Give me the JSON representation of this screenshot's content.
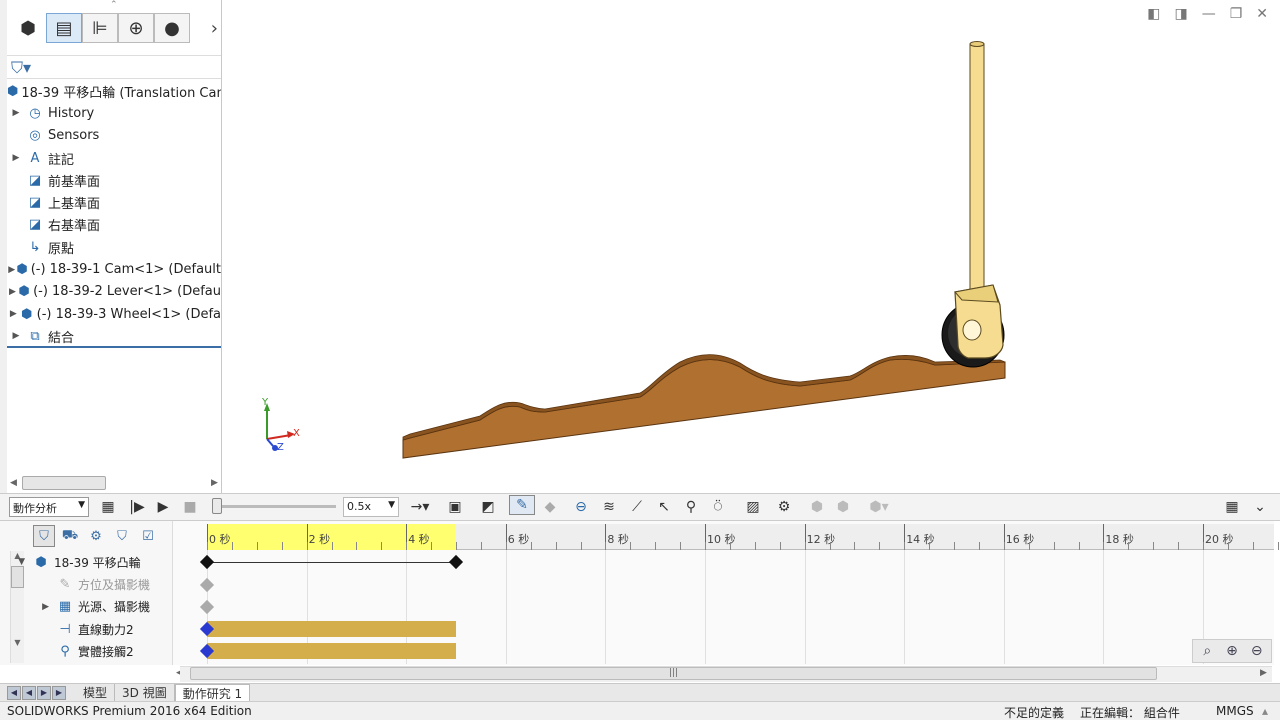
{
  "feature_tree": {
    "root": "18-39 平移凸輪 (Translation Cam",
    "items": [
      {
        "label": "History",
        "expand": true,
        "icon": "history-icon"
      },
      {
        "label": "Sensors",
        "expand": false,
        "icon": "sensors-icon"
      },
      {
        "label": "註記",
        "expand": true,
        "icon": "annotation-icon"
      },
      {
        "label": "前基準面",
        "expand": false,
        "icon": "plane-icon"
      },
      {
        "label": "上基準面",
        "expand": false,
        "icon": "plane-icon"
      },
      {
        "label": "右基準面",
        "expand": false,
        "icon": "plane-icon"
      },
      {
        "label": "原點",
        "expand": false,
        "icon": "origin-icon"
      },
      {
        "label": "(-) 18-39-1 Cam<1> (Default",
        "expand": true,
        "icon": "part-icon"
      },
      {
        "label": "(-) 18-39-2 Lever<1> (Defau",
        "expand": true,
        "icon": "part-icon"
      },
      {
        "label": "(-) 18-39-3 Wheel<1> (Defa",
        "expand": true,
        "icon": "part-icon"
      },
      {
        "label": "結合",
        "expand": true,
        "icon": "mates-icon"
      }
    ]
  },
  "axes_triad": {
    "x": "X",
    "y": "Y",
    "z": "Z"
  },
  "motion": {
    "study_type": "動作分析",
    "speed": "0.5x",
    "time_labels": [
      "0 秒",
      "2 秒",
      "4 秒",
      "6 秒",
      "8 秒",
      "10 秒",
      "12 秒",
      "14 秒",
      "16 秒",
      "18 秒",
      "20 秒"
    ],
    "highlight_end_sec": 5,
    "tree": [
      {
        "label": "18-39 平移凸輪",
        "expand": "down",
        "dim": false
      },
      {
        "label": "方位及攝影機",
        "expand": "",
        "dim": true
      },
      {
        "label": "光源、攝影機",
        "expand": "right",
        "dim": false
      },
      {
        "label": "直線動力2",
        "expand": "",
        "dim": false
      },
      {
        "label": "實體接觸2",
        "expand": "",
        "dim": false
      }
    ]
  },
  "tabs": {
    "model": "模型",
    "view3d": "3D 視圖",
    "study": "動作研究 1"
  },
  "status": {
    "product": "SOLIDWORKS Premium 2016 x64 Edition",
    "underdefined": "不足的定義",
    "editing": "正在編輯： 組合件",
    "units": "MMGS"
  },
  "colors": {
    "cam": "#b07030",
    "follower": "#f5dc90",
    "wheel": "#1a1a1a",
    "bar": "#d4ae4a",
    "ruler_highlight": "#ffff70",
    "accent": "#3a6ea5"
  }
}
